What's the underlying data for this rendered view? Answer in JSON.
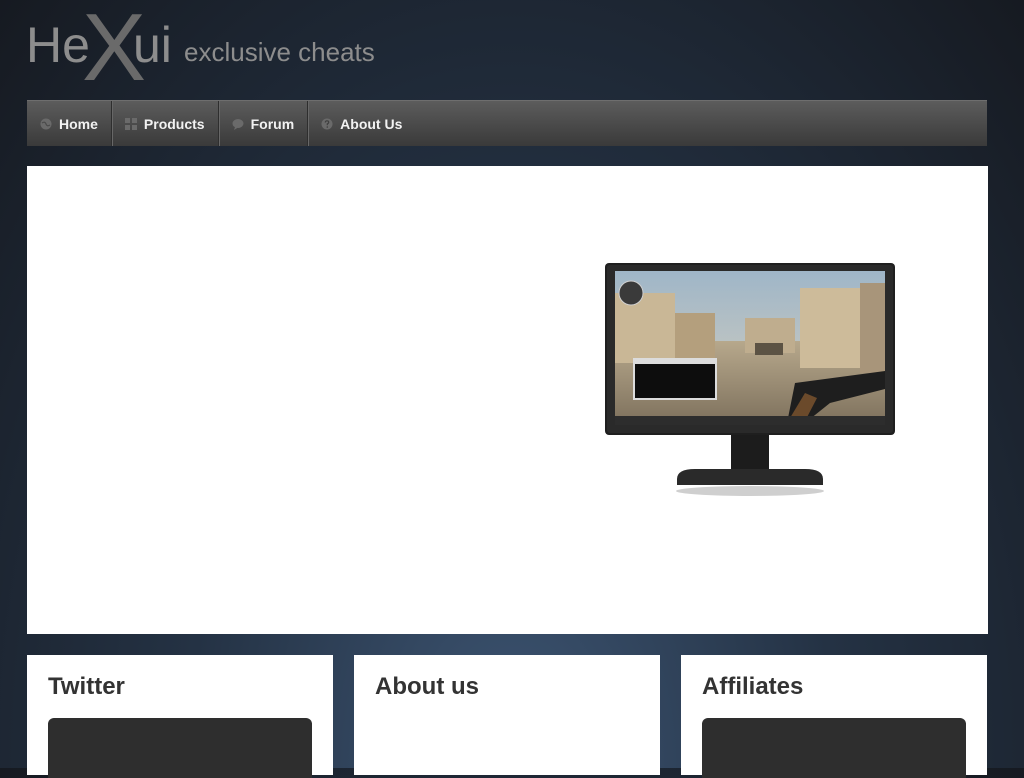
{
  "logo": {
    "brand_a": "He",
    "brand_x": "X",
    "brand_b": "ui",
    "tagline": "exclusive cheats"
  },
  "nav": {
    "items": [
      {
        "label": "Home",
        "icon": "globe-icon"
      },
      {
        "label": "Products",
        "icon": "grid-icon"
      },
      {
        "label": "Forum",
        "icon": "chat-bubble-icon"
      },
      {
        "label": "About Us",
        "icon": "question-icon"
      }
    ]
  },
  "hero": {
    "image": "monitor-showing-game-screenshot"
  },
  "panels": {
    "twitter": {
      "title": "Twitter"
    },
    "about": {
      "title": "About us"
    },
    "affiliates": {
      "title": "Affiliates"
    }
  },
  "colors": {
    "navbar": "#4a4a4a",
    "panel_title": "#333333",
    "embed_bg": "#2e2e2e"
  }
}
